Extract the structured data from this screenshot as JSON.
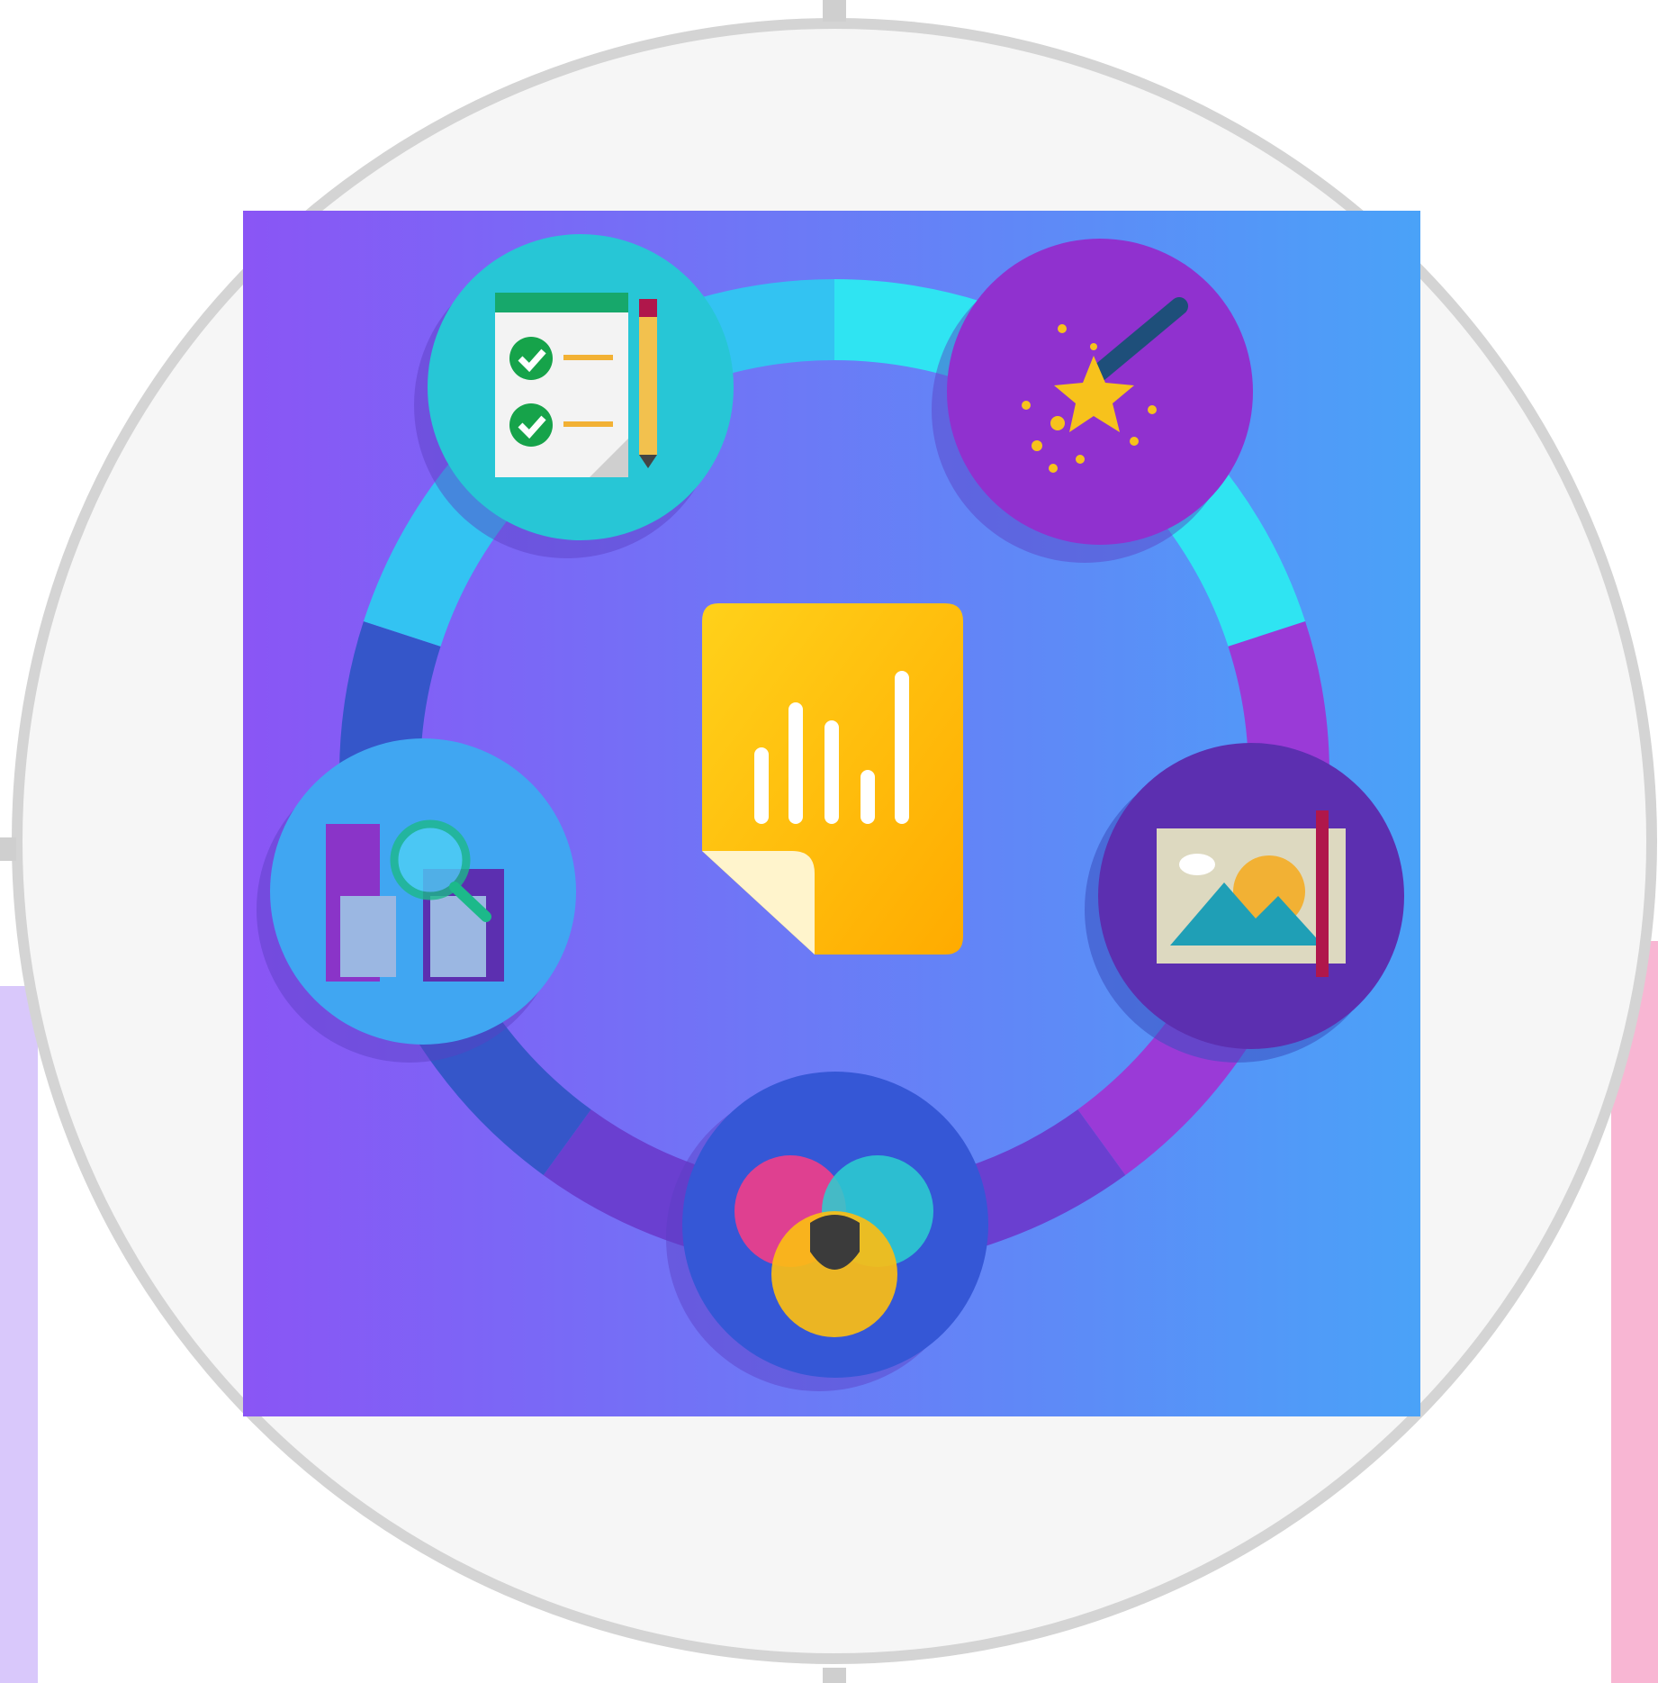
{
  "canvas": {
    "background": "#ffffff",
    "frame_fill": "#f6f6f6",
    "frame_stroke": "#d4d4d4"
  },
  "side_strips": {
    "left_color": "#d9c8fb",
    "right_color": "#f8b6d3"
  },
  "illustration": {
    "gradient_start": "#8a55f5",
    "gradient_end": "#4aa2f8",
    "ring_colors": [
      "#2fe4f2",
      "#9a3ad7",
      "#6a3fd0",
      "#3556c9",
      "#33c3f2"
    ],
    "center_icon": "bar-chart-document-icon",
    "center_color": "#ffc107",
    "nodes": [
      {
        "icon": "checklist-icon",
        "color": "#27c6d6"
      },
      {
        "icon": "magic-wand-icon",
        "color": "#9031cf"
      },
      {
        "icon": "picture-frame-icon",
        "color": "#5c2fb0"
      },
      {
        "icon": "venn-diagram-icon",
        "color": "#3557d6"
      },
      {
        "icon": "data-search-icon",
        "color": "#40a6f2"
      }
    ]
  }
}
